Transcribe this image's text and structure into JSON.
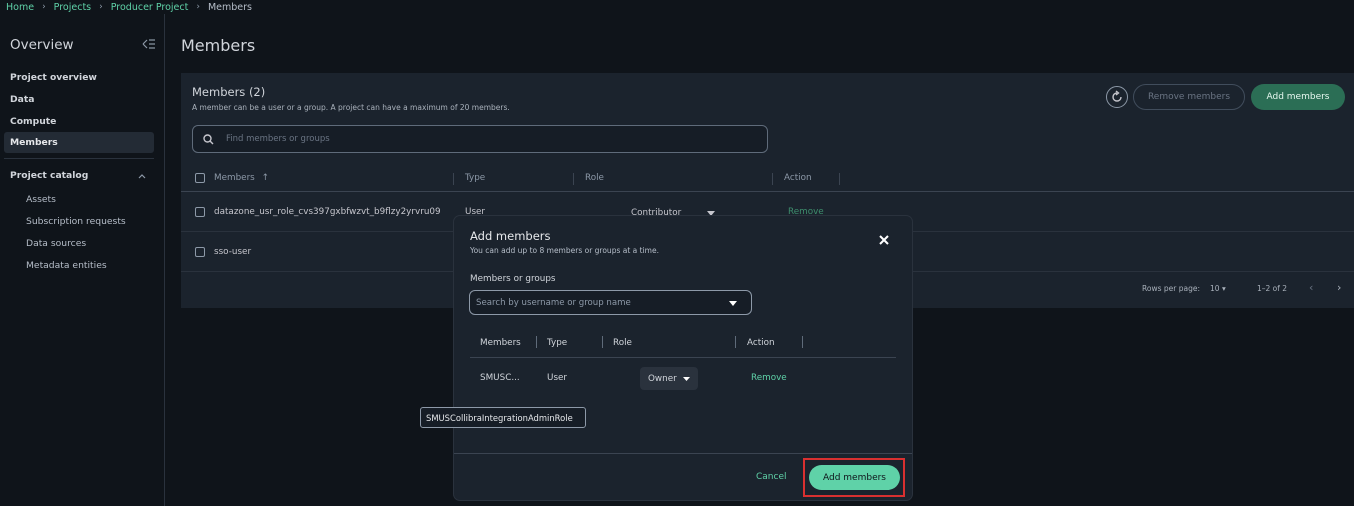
{
  "breadcrumb": {
    "home": "Home",
    "projects": "Projects",
    "project": "Producer Project",
    "current": "Members"
  },
  "sidebar": {
    "title": "Overview",
    "items": [
      {
        "label": "Project overview"
      },
      {
        "label": "Data"
      },
      {
        "label": "Compute"
      },
      {
        "label": "Members"
      }
    ],
    "catalog": {
      "label": "Project catalog",
      "subitems": [
        "Assets",
        "Subscription requests",
        "Data sources",
        "Metadata entities"
      ]
    }
  },
  "page": {
    "title": "Members"
  },
  "panel": {
    "title": "Members (2)",
    "description": "A member can be a user or a group. A project can have a maximum of 20 members.",
    "remove_label": "Remove members",
    "add_label": "Add members",
    "search_placeholder": "Find members or groups",
    "columns": [
      "Members",
      "Type",
      "Role",
      "Action"
    ],
    "rows": [
      {
        "member": "datazone_usr_role_cvs397gxbfwzvt_b9flzy2yrvru09",
        "type": "User",
        "role": "Contributor",
        "action": "Remove"
      },
      {
        "member": "sso-user",
        "type": "",
        "role": "",
        "action": ""
      }
    ],
    "rows_per_page_label": "Rows per page:",
    "rows_per_page": "10",
    "range": "1–2 of 2"
  },
  "modal": {
    "title": "Add members",
    "subtitle": "You can add up to 8 members or groups at a time.",
    "field_label": "Members or groups",
    "select_placeholder": "Search by username or group name",
    "columns": [
      "Members",
      "Type",
      "Role",
      "Action"
    ],
    "row": {
      "member": "SMUSC...",
      "type": "User",
      "role": "Owner",
      "action": "Remove"
    },
    "cancel_label": "Cancel",
    "add_label": "Add members"
  },
  "tooltip": {
    "text": "SMUSCollibraIntegrationAdminRole"
  },
  "colors": {
    "accent": "#5fd2a8",
    "accent_dark": "#2b6e55",
    "highlight": "#d93030",
    "bg": "#0f141a",
    "panel": "#1b232d"
  }
}
